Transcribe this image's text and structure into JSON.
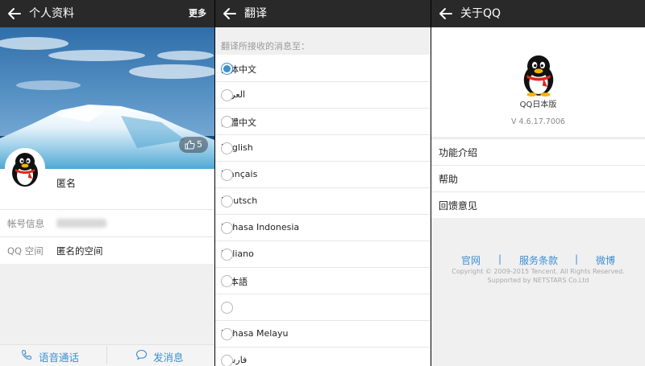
{
  "profile": {
    "title": "个人资料",
    "more": "更多",
    "like_count": "5",
    "name": "匿名",
    "rows": [
      {
        "label": "帐号信息",
        "value": ""
      },
      {
        "label": "QQ 空间",
        "value": "匿名的空间"
      }
    ],
    "actions": {
      "voice": "语音通话",
      "message": "发消息"
    }
  },
  "translate": {
    "title": "翻译",
    "hint": "翻译所接收的消息至：",
    "languages": [
      {
        "label": "简体中文",
        "selected": true
      },
      {
        "label": "العربية",
        "selected": false
      },
      {
        "label": "繁體中文",
        "selected": false
      },
      {
        "label": "English",
        "selected": false
      },
      {
        "label": "Français",
        "selected": false
      },
      {
        "label": "Deutsch",
        "selected": false
      },
      {
        "label": "Bahasa Indonesia",
        "selected": false
      },
      {
        "label": "Italiano",
        "selected": false
      },
      {
        "label": "日本語",
        "selected": false
      },
      {
        "label": "",
        "selected": false
      },
      {
        "label": "Bahasa Melayu",
        "selected": false
      },
      {
        "label": "فارسی",
        "selected": false
      }
    ]
  },
  "about": {
    "title": "关于QQ",
    "brand": "QQ日本版",
    "version": "V 4.6.17.7006",
    "menu": [
      "功能介绍",
      "帮助",
      "回馈意见"
    ],
    "links": {
      "site": "官网",
      "sep": "|",
      "terms": "服务条款",
      "weibo": "微博"
    },
    "copyright": "Copyright © 2009-2015 Tencent. All Rights Reserved.",
    "supported": "Supported by NETSTARS Co.Ltd"
  },
  "colors": {
    "accent": "#3b8fd4",
    "topbar": "#292929",
    "background": "#f0f0f0"
  },
  "icons": {
    "back": "arrow-left-icon",
    "like": "thumbs-up-icon",
    "phone": "phone-icon",
    "chat": "chat-bubble-icon",
    "penguin": "qq-penguin-icon"
  }
}
